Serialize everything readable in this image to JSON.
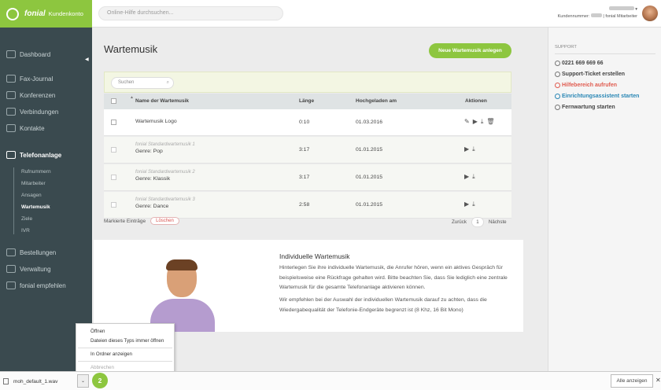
{
  "brand": {
    "name": "fonial",
    "subtitle": "Kundenkonto",
    "color": "#8dc63f"
  },
  "search": {
    "placeholder": "Online-Hilfe durchsuchen..."
  },
  "user": {
    "number_label": "Kundennummer:",
    "role": "fonial Mitarbeiter"
  },
  "sidebar": {
    "items": [
      {
        "label": "Dashboard"
      },
      {
        "label": "Fax-Journal"
      },
      {
        "label": "Konferenzen"
      },
      {
        "label": "Verbindungen"
      },
      {
        "label": "Kontakte"
      },
      {
        "label": "Telefonanlage"
      },
      {
        "label": "Bestellungen"
      },
      {
        "label": "Verwaltung"
      },
      {
        "label": "fonial empfehlen"
      }
    ],
    "sub": [
      {
        "label": "Rufnummern"
      },
      {
        "label": "Mitarbeiter"
      },
      {
        "label": "Ansagen"
      },
      {
        "label": "Wartemusik"
      },
      {
        "label": "Ziele"
      },
      {
        "label": "IVR"
      }
    ]
  },
  "page": {
    "title": "Wartemusik",
    "new_button": "Neue Wartemusik anlegen",
    "filter_placeholder": "Suchen"
  },
  "table": {
    "headers": {
      "name": "Name der Wartemusik",
      "length": "Länge",
      "uploaded": "Hochgeladen am",
      "actions": "Aktionen"
    },
    "rows": [
      {
        "standard": "",
        "name": "Wartemusik Logo",
        "length": "0:10",
        "date": "01.03.2016",
        "actions": "✎▶⤓🗑"
      },
      {
        "standard": "fonial Standardwartemusik 1",
        "name": "Genre: Pop",
        "length": "3:17",
        "date": "01.01.2015",
        "actions": "▶⤓"
      },
      {
        "standard": "fonial Standardwartemusik 2",
        "name": "Genre: Klassik",
        "length": "3:17",
        "date": "01.01.2015",
        "actions": "▶⤓"
      },
      {
        "standard": "fonial Standardwartemusik 3",
        "name": "Genre: Dance",
        "length": "2:58",
        "date": "01.01.2015",
        "actions": "▶⤓"
      }
    ]
  },
  "bulk": {
    "label": "Markierte Einträge",
    "delete": "Löschen"
  },
  "pager": {
    "prev": "Zurück",
    "page": "1",
    "next": "Nächste"
  },
  "info": {
    "title": "Individuelle Wartemusik",
    "p1": "Hinterlegen Sie ihre individuelle Wartemusik, die Anrufer hören, wenn ein aktives Gespräch für beispielsweise eine Rückfrage gehalten wird. Bitte beachten Sie, dass Sie lediglich eine zentrale Wartemusik für die gesamte Telefonanlage aktivieren können.",
    "p2": "Wir empfehlen bei der Auswahl der individuellen Wartemusik darauf zu achten, dass die Wiedergabequalität der Telefonie-Endgeräte begrenzt ist (8 Khz, 16 Bit Mono)"
  },
  "support": {
    "heading": "SUPPORT",
    "phone": "0221 669 669 66",
    "ticket": "Support-Ticket erstellen",
    "help": "Hilfebereich aufrufen",
    "wizard": "Einrichtungsassistent starten",
    "remote": "Fernwartung starten"
  },
  "context_menu": {
    "open": "Öffnen",
    "always_open": "Dateien dieses Typs immer öffnen",
    "show_in_folder": "In Ordner anzeigen",
    "cancel": "Abbrechen"
  },
  "download_bar": {
    "file": "moh_default_1.wav",
    "step_badge": "2",
    "show_all": "Alle anzeigen",
    "close": "✕"
  }
}
